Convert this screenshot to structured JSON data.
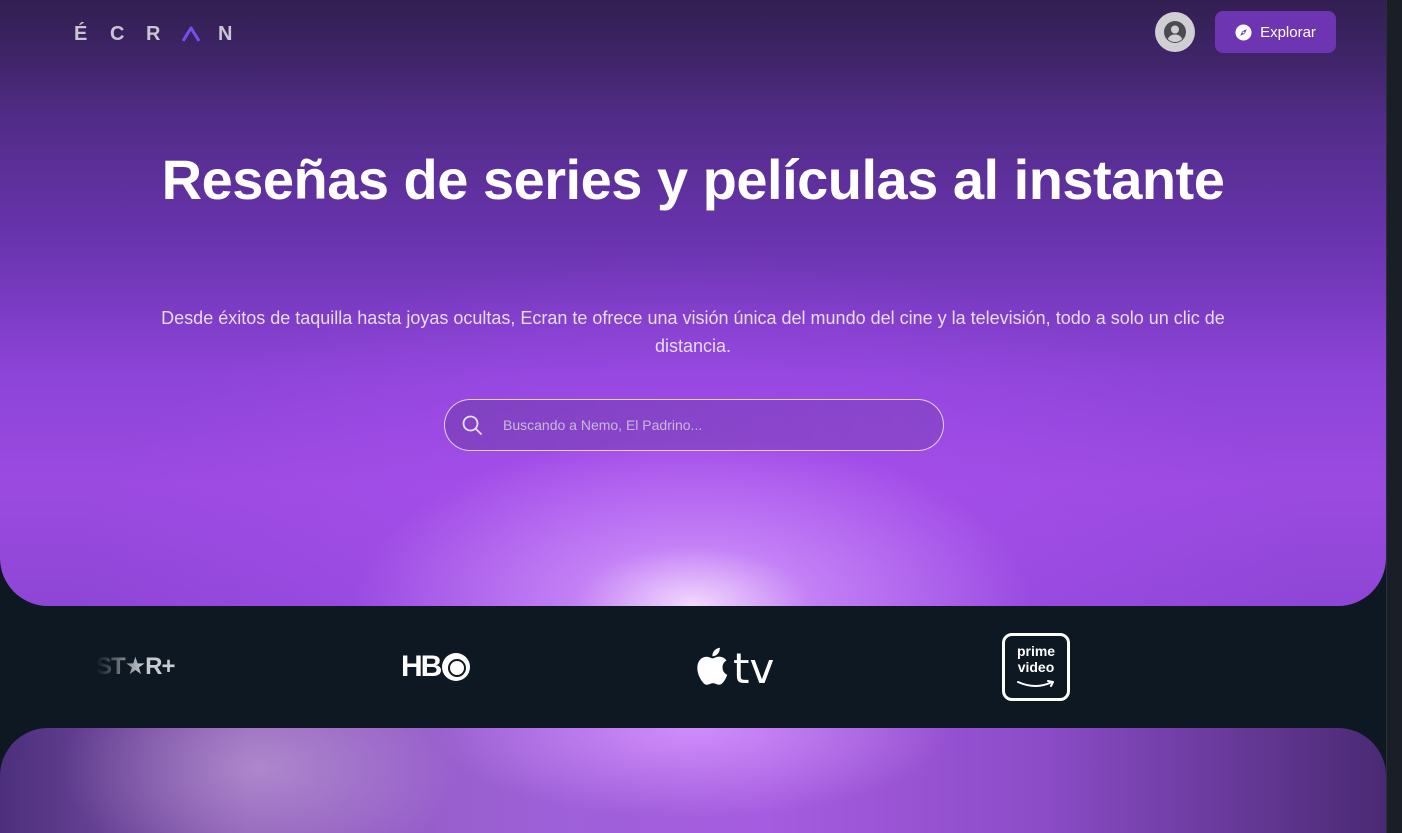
{
  "header": {
    "logo_letters": [
      "É",
      "C",
      "R",
      "Λ",
      "N"
    ],
    "explore_label": "Explorar",
    "logo_accent_color": "#7a4df0",
    "button_color": "#6e35b3"
  },
  "hero": {
    "title": "Reseñas de series y películas al instante",
    "subtitle": "Desde éxitos de taquilla hasta joyas ocultas, Ecran te ofrece una visión única del mundo del cine y la televisión, todo a solo un clic de distancia.",
    "search_placeholder": "Buscando a Nemo, El Padrino..."
  },
  "brands": {
    "star_plus": "ST★R+",
    "hbo_prefix": "HB",
    "apple_tv": "tv",
    "prime_line1": "prime",
    "prime_line2": "video"
  },
  "icons": {
    "avatar": "user-avatar-icon",
    "explore": "compass-icon",
    "search": "search-icon"
  },
  "colors": {
    "page_background": "#0e1822",
    "hero_top": "#3b2460",
    "hero_bottom": "#9b4ae0"
  }
}
